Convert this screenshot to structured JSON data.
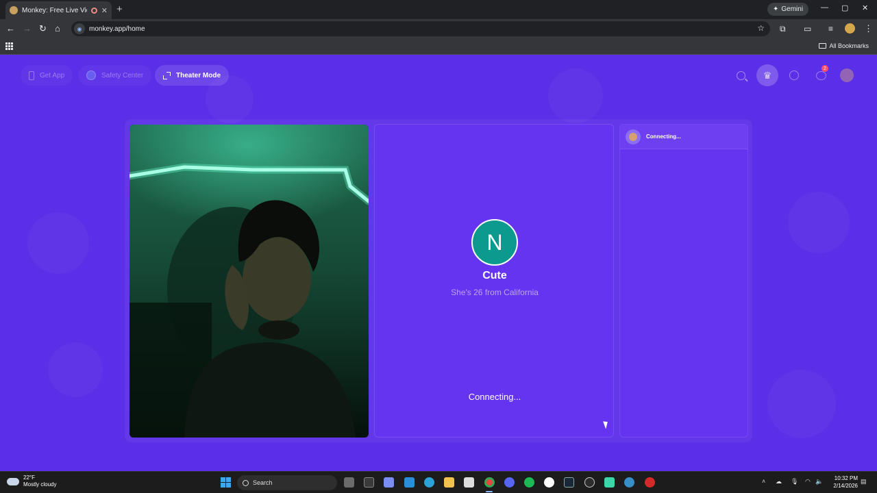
{
  "browser": {
    "tab_title": "Monkey: Free Live Video Ch",
    "tab_close": "✕",
    "new_tab": "+",
    "gemini_label": "Gemini",
    "url": "monkey.app/home",
    "all_bookmarks": "All Bookmarks",
    "window_controls": {
      "minimize": "—",
      "maximize": "▢",
      "close": "✕"
    }
  },
  "nav": {
    "get_app": "Get App",
    "safety_center": "Safety Center",
    "theater_mode": "Theater Mode",
    "messages_badge": "2"
  },
  "peer": {
    "initial": "N",
    "name": "Cute",
    "bio": "She's 26 from California",
    "status": "Connecting..."
  },
  "chat": {
    "status": "Connecting..."
  },
  "taskbar": {
    "temperature": "22°F",
    "weather": "Mostly cloudy",
    "search_label": "Search",
    "time": "10:32 PM",
    "date": "2/14/2026"
  },
  "colors": {
    "page_bg": "#5b2ee8",
    "panel": "#6534f0",
    "avatar": "#0d9a8e"
  }
}
